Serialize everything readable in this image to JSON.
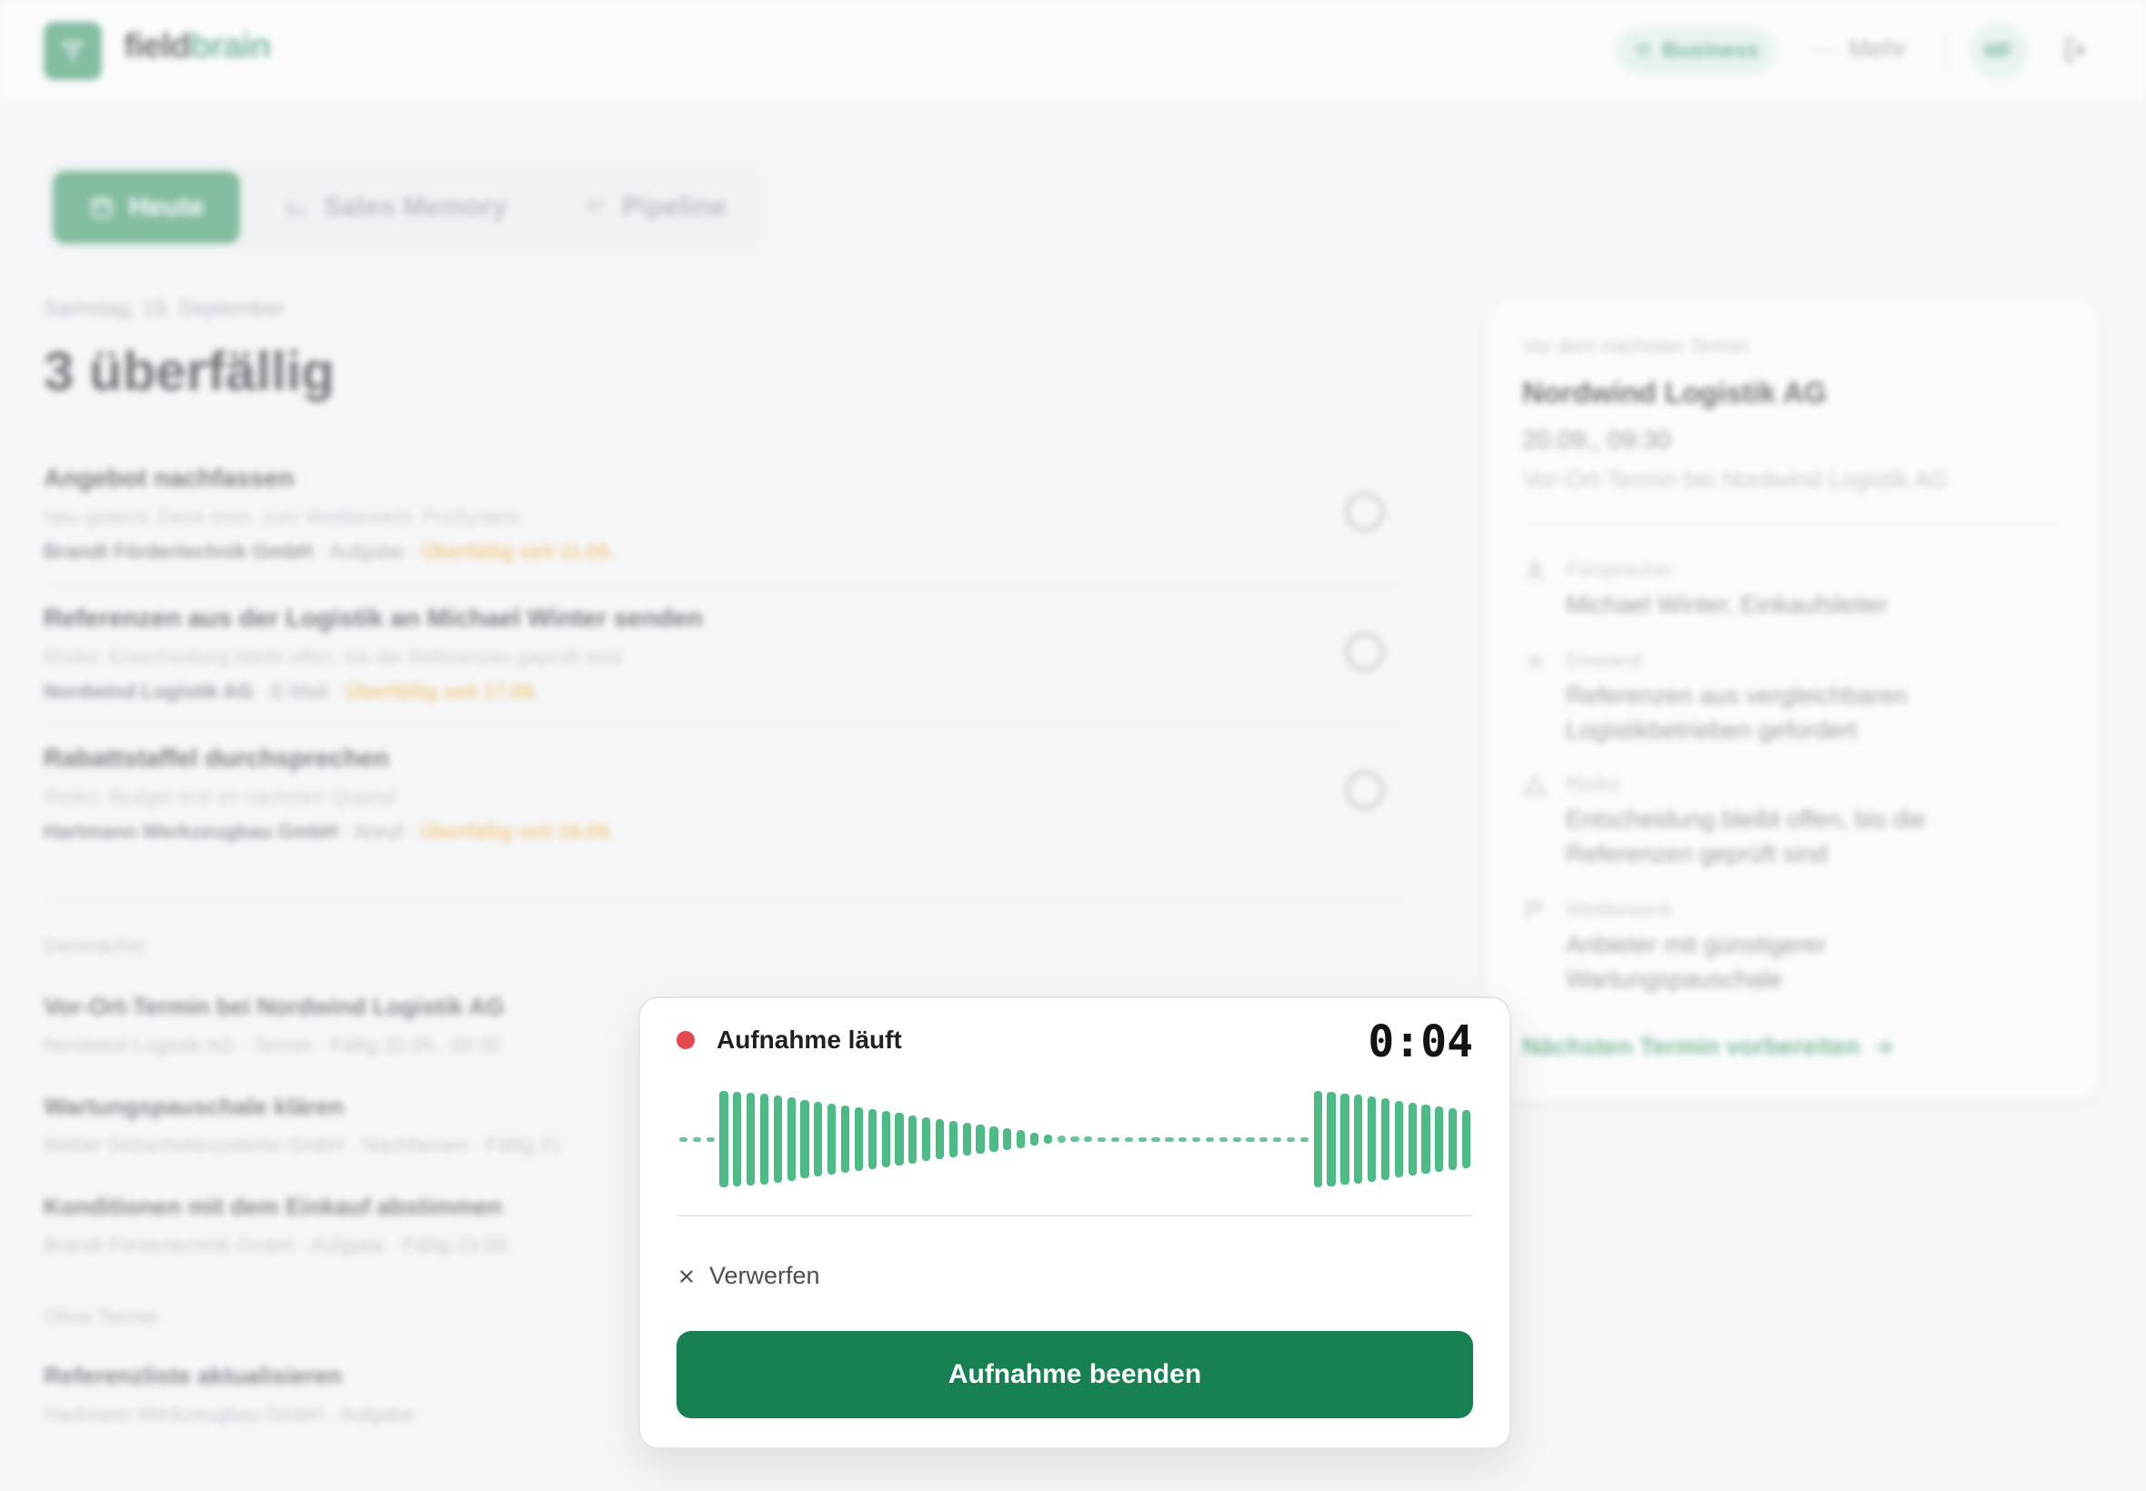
{
  "header": {
    "brand_a": "field",
    "brand_b": "brain",
    "plan_badge": "Business",
    "more_label": "Mehr",
    "avatar_initials": "MF"
  },
  "tabs": [
    {
      "label": "Heute",
      "active": true
    },
    {
      "label": "Sales Memory",
      "active": false
    },
    {
      "label": "Pipeline",
      "active": false
    }
  ],
  "today": {
    "date": "Samstag, 19. September",
    "headline": "3 überfällig",
    "overdue": [
      {
        "title": "Angebot nachfassen",
        "note": "Neu gelernt: Denk dran, zum Wettbewerb: ProSystem.",
        "company": "Brandt Fördertechnik GmbH",
        "kind": "Aufgabe",
        "due": "Überfällig seit 11.09."
      },
      {
        "title": "Referenzen aus der Logistik an Michael Winter senden",
        "note": "Risiko: Entscheidung bleibt offen, bis die Referenzen geprüft sind",
        "company": "Nordwind Logistik AG",
        "kind": "E-Mail",
        "due": "Überfällig seit 17.09."
      },
      {
        "title": "Rabattstaffel durchsprechen",
        "note": "Risiko: Budget erst im nächsten Quartal",
        "company": "Hartmann Werkzeugbau GmbH",
        "kind": "Anruf",
        "due": "Überfällig seit 18.09."
      }
    ],
    "upcoming_label": "Demnächst",
    "upcoming": [
      {
        "title": "Vor-Ort-Termin bei Nordwind Logistik AG",
        "meta": "Nordwind Logistik AG · Termin · Fällig 20.09., 09:30"
      },
      {
        "title": "Wartungspauschale klären",
        "meta": "Weber Sicherheitssysteme GmbH · Nachfassen · Fällig 21"
      },
      {
        "title": "Konditionen mit dem Einkauf abstimmen",
        "meta": "Brandt Fördertechnik GmbH · Aufgabe · Fällig 23.09."
      }
    ],
    "no_date_label": "Ohne Termin",
    "no_date": [
      {
        "title": "Referenzliste aktualisieren",
        "meta": "Hartmann Werkzeugbau GmbH · Aufgabe"
      }
    ]
  },
  "next_meeting": {
    "label": "Vor dem nächsten Termin",
    "company": "Nordwind Logistik AG",
    "when": "20.09., 09:30",
    "description": "Vor-Ort-Termin bei Nordwind Logistik AG",
    "facts": [
      {
        "key": "Fürsprecher",
        "value": "Michael Winter, Einkaufsleiter",
        "icon": "person-icon"
      },
      {
        "key": "Einwand",
        "value": "Referenzen aus vergleichbaren Logistikbetrieben gefordert",
        "icon": "x-icon"
      },
      {
        "key": "Risiko",
        "value": "Entscheidung bleibt offen, bis die Referenzen geprüft sind",
        "icon": "warning-icon"
      },
      {
        "key": "Wettbewerb",
        "value": "Anbieter mit günstigerer Wartungspauschale",
        "icon": "flag-icon"
      }
    ],
    "cta": "Nächsten Termin vorbereiten"
  },
  "recording": {
    "title": "Aufnahme läuft",
    "timer": "0:04",
    "discard_label": "Verwerfen",
    "stop_label": "Aufnahme beenden",
    "wave_levels": [
      0.04,
      0.04,
      0.04,
      1.0,
      0.98,
      0.96,
      0.94,
      0.9,
      0.86,
      0.82,
      0.78,
      0.74,
      0.7,
      0.66,
      0.62,
      0.58,
      0.54,
      0.5,
      0.46,
      0.42,
      0.38,
      0.34,
      0.3,
      0.26,
      0.22,
      0.18,
      0.14,
      0.1,
      0.08,
      0.06,
      0.05,
      0.04,
      0.04,
      0.04,
      0.04,
      0.04,
      0.04,
      0.04,
      0.04,
      0.04,
      0.04,
      0.04,
      0.04,
      0.04,
      0.04,
      0.04,
      0.04,
      1.0,
      0.98,
      0.95,
      0.92,
      0.88,
      0.84,
      0.8,
      0.76,
      0.72,
      0.68,
      0.64,
      0.6
    ],
    "accent": "#178152",
    "wave_color": "#4cbb86",
    "rec_color": "#e5484d"
  }
}
